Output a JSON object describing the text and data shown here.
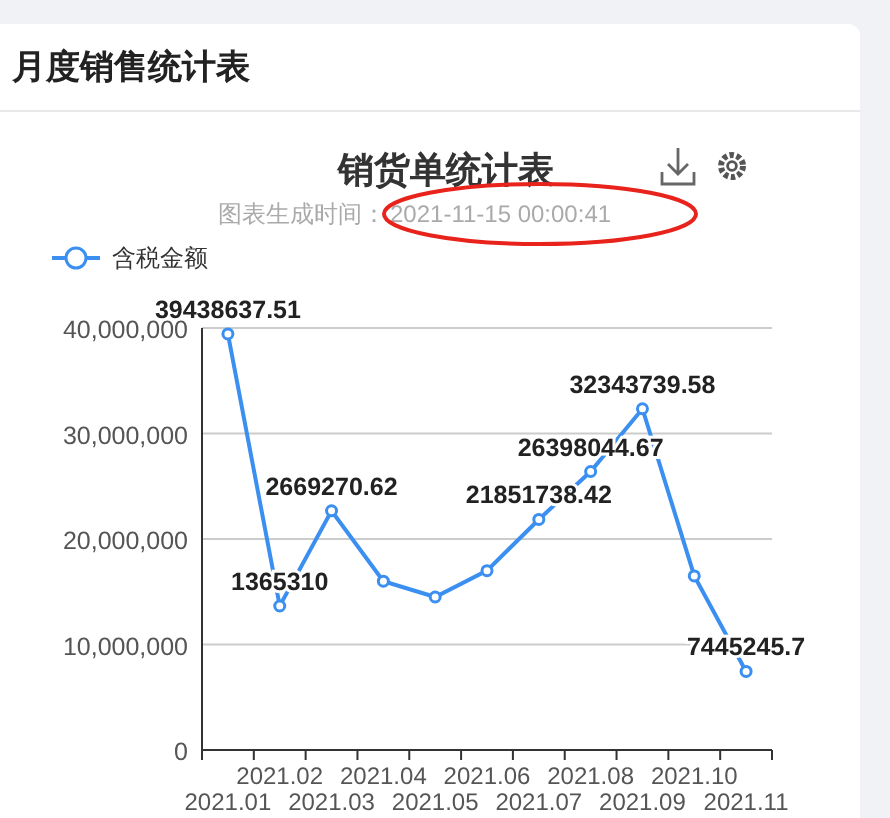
{
  "card": {
    "title": "月度销售统计表"
  },
  "chart": {
    "title": "销货单统计表",
    "subtitle_label": "图表生成时间：",
    "generated_at": "2021-11-15 00:00:41",
    "highlighted": true,
    "chart_data": {
      "type": "line",
      "categories": [
        "2021.01",
        "2021.02",
        "2021.03",
        "2021.04",
        "2021.05",
        "2021.06",
        "2021.07",
        "2021.08",
        "2021.09",
        "2021.10",
        "2021.11"
      ],
      "series": [
        {
          "name": "含税金额",
          "color": "#3b8ff0",
          "marker": "circle",
          "values": [
            39438637.51,
            13650000,
            22670000,
            16000000,
            14500000,
            17000000,
            21851738.42,
            26398044.67,
            32343739.58,
            16500000,
            7445245.7
          ]
        }
      ],
      "ylim": [
        0,
        40000000
      ],
      "yticks": [
        {
          "value": 0,
          "label": "0"
        },
        {
          "value": 10000000,
          "label": "10,000,000"
        },
        {
          "value": 20000000,
          "label": "20,000,000"
        },
        {
          "value": 30000000,
          "label": "30,000,000"
        },
        {
          "value": 40000000,
          "label": "40,000,000"
        }
      ],
      "value_labels": [
        "39438637.51",
        "1365310",
        "2669270.62",
        null,
        null,
        null,
        "21851738.42",
        "26398044.67",
        "32343739.58",
        null,
        "7445245.7"
      ],
      "grid": true
    }
  }
}
